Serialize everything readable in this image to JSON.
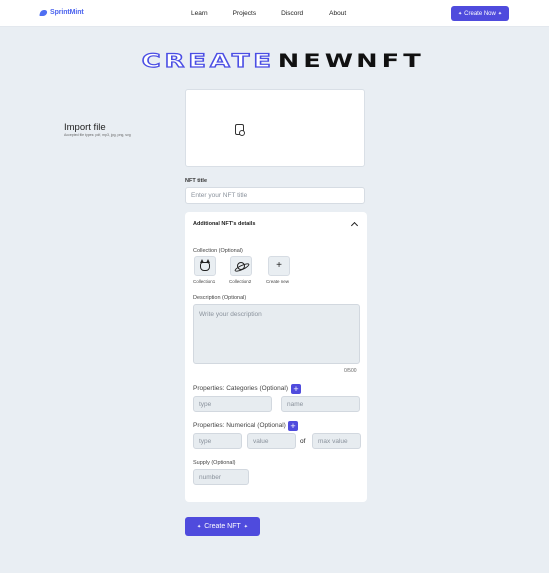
{
  "brand": {
    "name": "SprintMint",
    "color": "#4c64ee"
  },
  "nav": {
    "links": [
      "Learn",
      "Projects",
      "Discord",
      "About"
    ],
    "cta_label": "Create Now",
    "cta_icon": "sparkle-icon"
  },
  "hero": {
    "words": [
      "CREATE",
      "NEW",
      "NFT"
    ]
  },
  "upload": {
    "title": "Import file",
    "hint": "Accepted file types: pdf, mp3, jpg, png, svg",
    "icon": "file-icon"
  },
  "nft_title": {
    "label": "NFT title",
    "placeholder": "Enter your NFT title"
  },
  "details": {
    "title": "Additional NFT's details",
    "collection": {
      "label": "Collection (Optional)",
      "items": [
        {
          "label": "Collection1",
          "icon": "cat-icon"
        },
        {
          "label": "Collection2",
          "icon": "planet-icon"
        },
        {
          "label": "Create new",
          "icon": "plus-icon"
        }
      ]
    },
    "description": {
      "label": "Description (Optional)",
      "placeholder": "Write your description",
      "counter": "0/500"
    },
    "categories": {
      "label": "Properties: Categories (Optional)",
      "placeholders": [
        "type",
        "name"
      ]
    },
    "numerical": {
      "label": "Properties: Numerical (Optional)",
      "placeholders": [
        "type",
        "value",
        "max value"
      ],
      "of": "of"
    },
    "supply": {
      "label": "Supply (Optional)",
      "placeholder": "number"
    }
  },
  "submit_label": "Create NFT",
  "accent": "#4f4bdd"
}
